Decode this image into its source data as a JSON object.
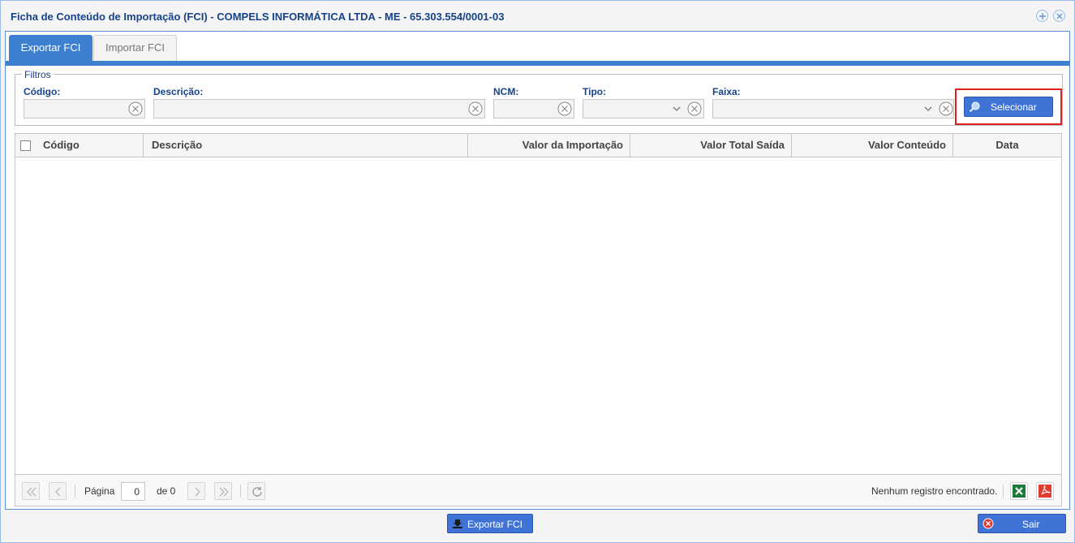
{
  "window": {
    "title": "Ficha de Conteúdo de Importação (FCI) - COMPELS INFORMÁTICA LTDA - ME - 65.303.554/0001-03"
  },
  "tabs": [
    {
      "label": "Exportar FCI",
      "active": true
    },
    {
      "label": "Importar FCI",
      "active": false
    }
  ],
  "filters": {
    "legend": "Filtros",
    "codigo_label": "Código:",
    "descricao_label": "Descrição:",
    "ncm_label": "NCM:",
    "tipo_label": "Tipo:",
    "faixa_label": "Faixa:",
    "codigo_value": "",
    "descricao_value": "",
    "ncm_value": "",
    "tipo_value": "",
    "faixa_value": "",
    "select_button": "Selecionar"
  },
  "grid": {
    "columns": [
      "Código",
      "Descrição",
      "Valor da Importação",
      "Valor Total Saída",
      "Valor Conteúdo",
      "Data"
    ],
    "rows": []
  },
  "pager": {
    "page_label": "Página",
    "page_value": "0",
    "of_label": "de 0",
    "status": "Nenhum registro encontrado."
  },
  "footer": {
    "export_button": "Exportar FCI",
    "exit_button": "Sair"
  },
  "colors": {
    "accent": "#3d7fd0",
    "title": "#15428b",
    "button": "#3f74d6",
    "highlight": "#e0201e"
  }
}
